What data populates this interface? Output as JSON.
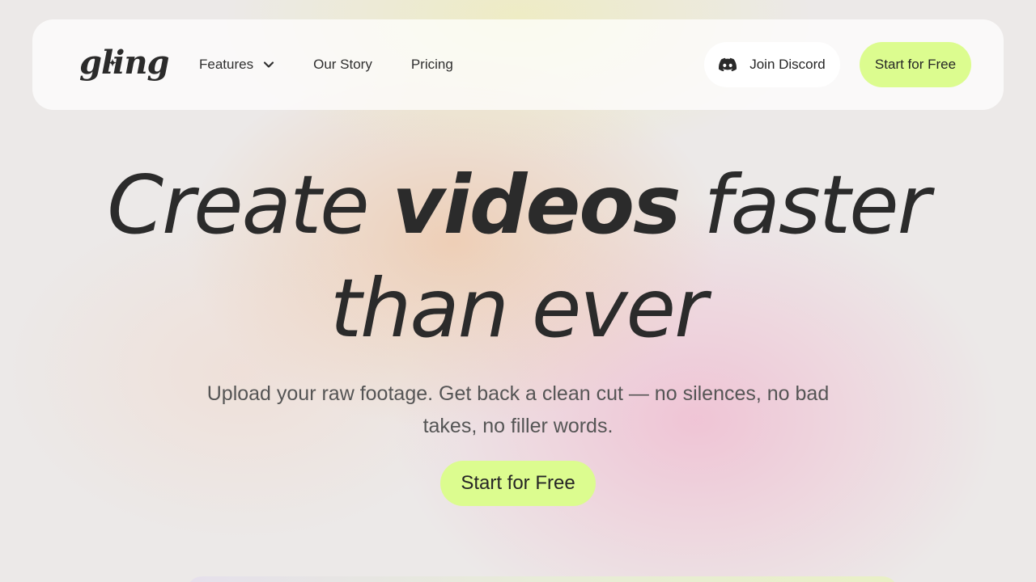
{
  "nav": {
    "logo": "gling",
    "links": [
      {
        "label": "Features",
        "has_dropdown": true,
        "icon": "chevron-down-icon"
      },
      {
        "label": "Our Story"
      },
      {
        "label": "Pricing"
      }
    ],
    "discord_label": "Join Discord",
    "discord_icon": "discord-icon",
    "cta_label": "Start for Free"
  },
  "hero": {
    "title_part1": "Create ",
    "title_bold": "videos",
    "title_part2": " faster",
    "title_line2": "than ever",
    "subtitle": "Upload your raw footage. Get back a clean cut — no silences, no bad takes, no filler words.",
    "cta_label": "Start for Free"
  },
  "colors": {
    "accent": "#dcfc8f",
    "text": "#2b2b2b",
    "subtitle": "#555555"
  }
}
